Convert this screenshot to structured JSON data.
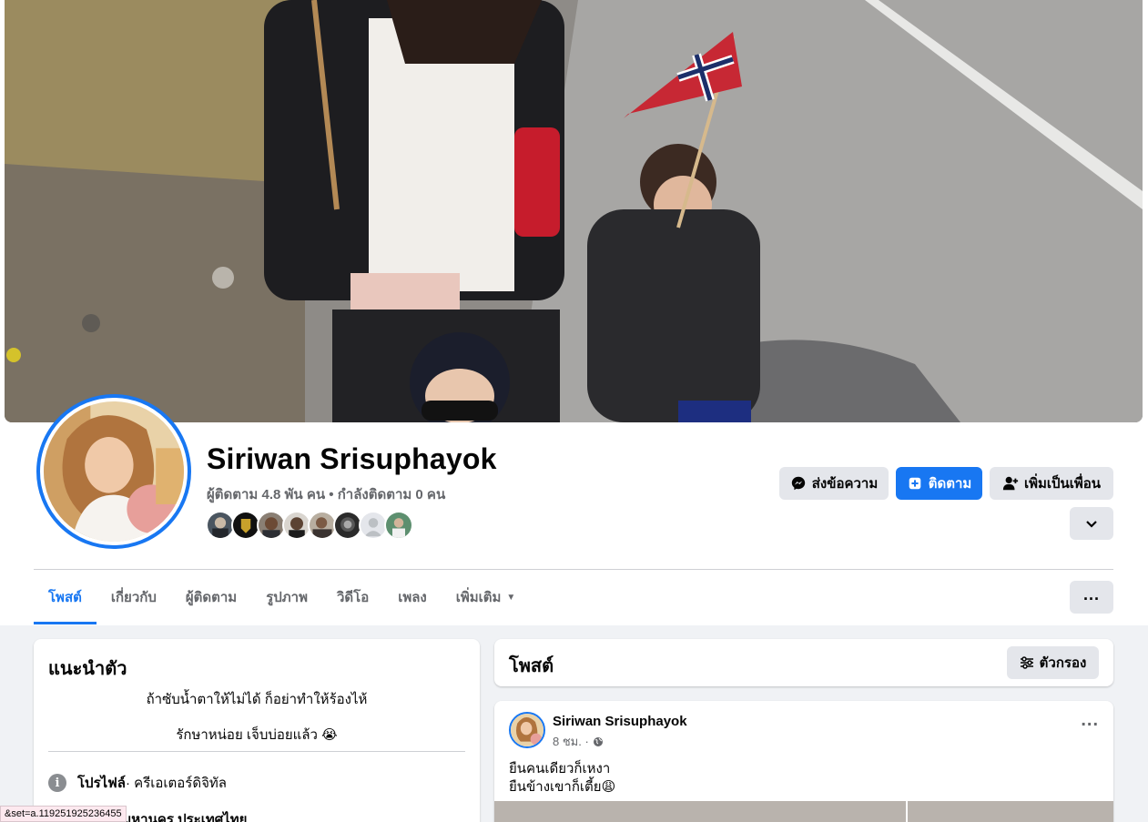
{
  "profile": {
    "name": "Siriwan Srisuphayok",
    "followers_line": "ผู้ติดตาม 4.8 พัน คน • กำลังติดตาม 0 คน"
  },
  "actions": {
    "message": "ส่งข้อความ",
    "follow": "ติดตาม",
    "add_friend": "เพิ่มเป็นเพื่อน"
  },
  "tabs": [
    {
      "label": "โพสต์"
    },
    {
      "label": "เกี่ยวกับ"
    },
    {
      "label": "ผู้ติดตาม"
    },
    {
      "label": "รูปภาพ"
    },
    {
      "label": "วิดีโอ"
    },
    {
      "label": "เพลง"
    },
    {
      "label": "เพิ่มเติม"
    }
  ],
  "intro": {
    "title": "แนะนำตัว",
    "bio_line1": "ถ้าซับน้ำตาให้ไม่ได้ ก็อย่าทำให้ร้องไห้",
    "bio_line2": "รักษาหน่อย เจ็บบ่อยแล้ว 😭",
    "profile_label": "โปรไฟล์",
    "profile_value": " · ครีเอเตอร์ดิจิทัล",
    "location": "กรุงเทพมหานคร ประเทศไทย"
  },
  "posts": {
    "title": "โพสต์",
    "filter": "ตัวกรอง",
    "items": [
      {
        "author": "Siriwan Srisuphayok",
        "time": "8 ชม. ·",
        "line1": "ยืนคนเดียวก็เหงา",
        "line2": "ยืนข้างเขาก็เตี้ย😩"
      }
    ]
  },
  "status_bar": {
    "url": "&set=a.119251925236455"
  },
  "icons": [
    "messenger-icon",
    "follow-plus-icon",
    "add-friend-icon",
    "chevron-down-icon",
    "more-dots-icon",
    "filter-icon",
    "info-icon",
    "globe-icon"
  ],
  "colors": {
    "accent": "#1877f2",
    "button_gray": "#e4e6eb",
    "page_bg": "#f0f2f5"
  }
}
